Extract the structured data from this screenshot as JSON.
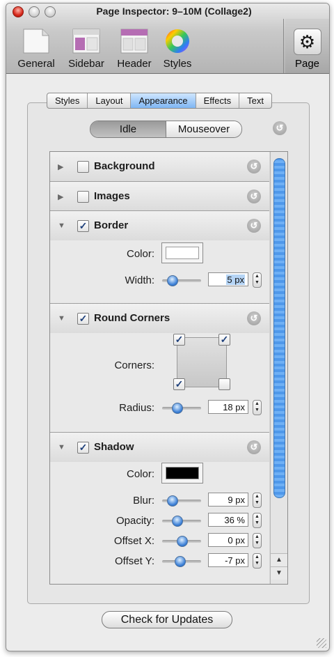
{
  "window": {
    "title": "Page Inspector: 9–10M (Collage2)"
  },
  "toolbar": {
    "items": [
      {
        "label": "General"
      },
      {
        "label": "Sidebar"
      },
      {
        "label": "Header"
      },
      {
        "label": "Styles"
      }
    ],
    "page_label": "Page"
  },
  "tabs": [
    {
      "label": "Styles"
    },
    {
      "label": "Layout"
    },
    {
      "label": "Appearance",
      "active": true
    },
    {
      "label": "Effects"
    },
    {
      "label": "Text"
    }
  ],
  "state_toggle": {
    "idle": "Idle",
    "mouseover": "Mouseover",
    "selected": "Idle"
  },
  "sections": {
    "background": {
      "title": "Background",
      "checked": false
    },
    "images": {
      "title": "Images",
      "checked": false
    },
    "border": {
      "title": "Border",
      "checked": true,
      "color_label": "Color:",
      "color": "#ffffff",
      "width_label": "Width:",
      "width_value": "5 px",
      "width_level": 0.2
    },
    "round_corners": {
      "title": "Round Corners",
      "checked": true,
      "corners_label": "Corners:",
      "corners": {
        "top_left": true,
        "top_right": true,
        "bottom_left": true,
        "bottom_right": false
      },
      "radius_label": "Radius:",
      "radius_value": "18 px",
      "radius_level": 0.3
    },
    "shadow": {
      "title": "Shadow",
      "checked": true,
      "color_label": "Color:",
      "color": "#000000",
      "blur_label": "Blur:",
      "blur_value": "9 px",
      "blur_level": 0.2,
      "opacity_label": "Opacity:",
      "opacity_value": "36 %",
      "opacity_level": 0.36,
      "offset_x_label": "Offset X:",
      "offset_x_value": "0 px",
      "offset_x_level": 0.5,
      "offset_y_label": "Offset Y:",
      "offset_y_value": "-7 px",
      "offset_y_level": 0.45
    }
  },
  "footer": {
    "check_updates_label": "Check for Updates"
  },
  "colors": {
    "accent": "#3b7fd6",
    "selected_tab": "#7fb6f3"
  },
  "icons": [
    "close-light",
    "minimize-light",
    "zoom-light",
    "general-icon",
    "sidebar-icon",
    "header-icon",
    "styles-icon",
    "gear-icon",
    "disclosure-triangle",
    "revert-icon",
    "checkbox",
    "slider-knob",
    "stepper-icon",
    "resize-grip-icon"
  ]
}
